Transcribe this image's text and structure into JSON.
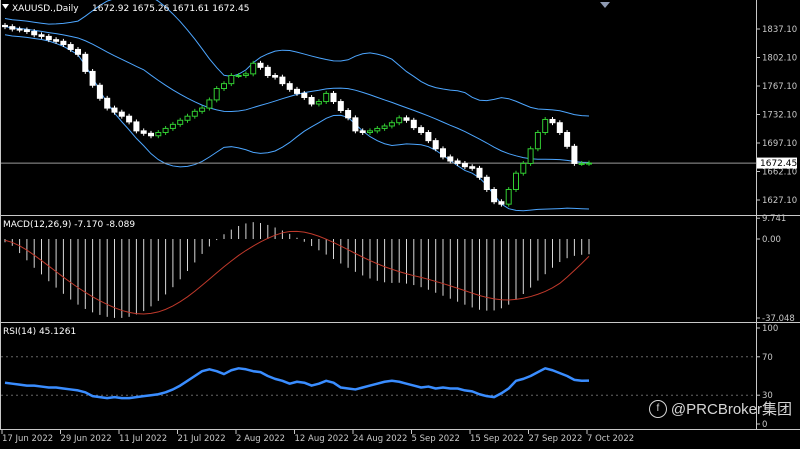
{
  "watermark": {
    "text": "@PRCBroker集团"
  },
  "price_panel": {
    "header": {
      "symbol": "XAUUSD.,Daily",
      "ohlc": "1672.92 1675.26 1671.61 1672.45"
    },
    "current_price": "1672.45",
    "y_ticks": [
      {
        "v": 1837.1,
        "label": "1837.10"
      },
      {
        "v": 1802.1,
        "label": "1802.10"
      },
      {
        "v": 1767.1,
        "label": "1767.10"
      },
      {
        "v": 1732.1,
        "label": "1732.10"
      },
      {
        "v": 1697.1,
        "label": "1697.10"
      },
      {
        "v": 1662.1,
        "label": "1662.10"
      },
      {
        "v": 1627.1,
        "label": "1627.10"
      }
    ]
  },
  "macd_panel": {
    "header": "MACD(12,26,9) -7.170 -8.089",
    "ticks": [
      {
        "v": 9.741,
        "label": "9.741"
      },
      {
        "v": 0,
        "label": "0.00"
      },
      {
        "v": -37.048,
        "label": "-37.048"
      }
    ]
  },
  "rsi_panel": {
    "header": "RSI(14) 45.1261",
    "ticks": [
      {
        "v": 100,
        "label": "100"
      },
      {
        "v": 70,
        "label": "70"
      },
      {
        "v": 30,
        "label": "30"
      },
      {
        "v": 0,
        "label": "0"
      }
    ]
  },
  "x_labels": [
    "17 Jun 2022",
    "29 Jun 2022",
    "11 Jul 2022",
    "21 Jul 2022",
    "2 Aug 2022",
    "12 Aug 2022",
    "24 Aug 2022",
    "5 Sep 2022",
    "15 Sep 2022",
    "27 Sep 2022",
    "7 Oct 2022"
  ],
  "colors": {
    "background": "#000000",
    "bull": "#32cd32",
    "bear": "#ffffff",
    "bands": "#4da6ff",
    "rsi": "#3a8dff",
    "signal": "#c0392b",
    "axis": "#c8c8c8"
  },
  "chart_data": {
    "type": "candlestick",
    "closes": [
      1840,
      1837,
      1836,
      1834,
      1830,
      1828,
      1824,
      1822,
      1818,
      1812,
      1806,
      1785,
      1768,
      1752,
      1740,
      1735,
      1730,
      1723,
      1712,
      1709,
      1706,
      1710,
      1715,
      1720,
      1725,
      1730,
      1736,
      1740,
      1750,
      1764,
      1770,
      1780,
      1780,
      1782,
      1795,
      1790,
      1780,
      1778,
      1770,
      1763,
      1758,
      1753,
      1745,
      1748,
      1758,
      1748,
      1737,
      1728,
      1712,
      1710,
      1712,
      1715,
      1718,
      1722,
      1728,
      1725,
      1716,
      1710,
      1700,
      1690,
      1680,
      1675,
      1672,
      1668,
      1666,
      1655,
      1640,
      1625,
      1622,
      1640,
      1660,
      1672,
      1690,
      1710,
      1726,
      1722,
      1710,
      1693,
      1672,
      1672,
      1672.45
    ],
    "macd": [
      -1.5,
      -3.2,
      -6.6,
      -10,
      -13.5,
      -16.6,
      -19.8,
      -22.8,
      -25.7,
      -28.4,
      -30.8,
      -32.8,
      -34.4,
      -35.6,
      -36.5,
      -37,
      -37,
      -36.5,
      -35.4,
      -33.8,
      -31.6,
      -29,
      -26,
      -22.6,
      -18.9,
      -15,
      -11,
      -7,
      -3.5,
      -0.5,
      2.2,
      4.4,
      6.1,
      7.3,
      7.9,
      7.5,
      6.6,
      5.4,
      4,
      2.4,
      0.6,
      -1.3,
      -3.3,
      -5.3,
      -7.3,
      -9.4,
      -11.5,
      -13.5,
      -15.4,
      -17.1,
      -18.5,
      -19.6,
      -20.3,
      -20.6,
      -20.5,
      -20.9,
      -21.6,
      -22.6,
      -23.8,
      -25.2,
      -26.6,
      -28,
      -29.4,
      -30.8,
      -32.1,
      -33.2,
      -33.6,
      -33.5,
      -32.5,
      -30.8,
      -28.5,
      -25.8,
      -22.8,
      -19.5,
      -16.5,
      -13.5,
      -10.8,
      -9,
      -7.9,
      -7.4,
      -7.17
    ],
    "signal": [
      -0.6,
      -1.6,
      -3.2,
      -5.2,
      -7.6,
      -10.1,
      -12.7,
      -15.3,
      -17.9,
      -20.4,
      -22.8,
      -25,
      -27.1,
      -29,
      -30.7,
      -32.2,
      -33.5,
      -34.4,
      -35,
      -35.2,
      -34.9,
      -34.2,
      -33,
      -31.4,
      -29.4,
      -27.1,
      -24.5,
      -21.7,
      -18.8,
      -15.9,
      -13,
      -10.3,
      -7.7,
      -5.4,
      -3.3,
      -1.4,
      0.3,
      1.8,
      2.9,
      3.5,
      3.6,
      3.2,
      2.4,
      1.3,
      -0.1,
      -1.6,
      -3.3,
      -5,
      -6.8,
      -8.5,
      -10.1,
      -11.6,
      -13,
      -14.2,
      -15.3,
      -16.3,
      -17.2,
      -18,
      -18.9,
      -19.9,
      -20.9,
      -22,
      -23.1,
      -24.2,
      -25.4,
      -26.5,
      -27.4,
      -28.1,
      -28.5,
      -28.6,
      -28.3,
      -27.8,
      -27,
      -25.9,
      -24.6,
      -22.9,
      -20.8,
      -17.9,
      -14.7,
      -11.5,
      -8.089
    ],
    "rsi": [
      43,
      42,
      41,
      40,
      40,
      39,
      38,
      38,
      37,
      36,
      35,
      33,
      29,
      28,
      27,
      28,
      27,
      27,
      28,
      29,
      30,
      31,
      33,
      36,
      40,
      45,
      50,
      55,
      57,
      55,
      52,
      56,
      58,
      57,
      55,
      54,
      50,
      47,
      45,
      42,
      44,
      43,
      40,
      42,
      45,
      43,
      38,
      37,
      36,
      38,
      40,
      42,
      44,
      45,
      44,
      42,
      40,
      38,
      39,
      37,
      38,
      37,
      37,
      35,
      34,
      31,
      29,
      28,
      32,
      37,
      45,
      47,
      50,
      54,
      58,
      56,
      53,
      50,
      46,
      45,
      45.13
    ]
  }
}
